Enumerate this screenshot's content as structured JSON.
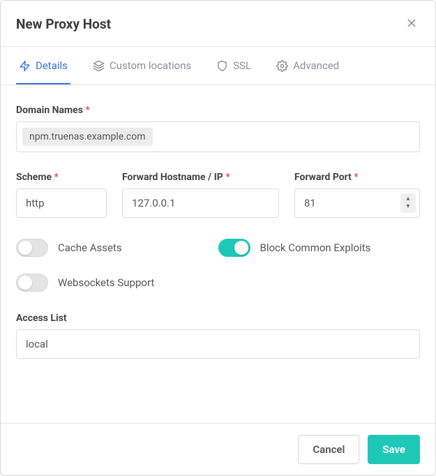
{
  "header": {
    "title": "New Proxy Host"
  },
  "tabs": {
    "details": "Details",
    "custom_locations": "Custom locations",
    "ssl": "SSL",
    "advanced": "Advanced"
  },
  "labels": {
    "domain_names": "Domain Names",
    "scheme": "Scheme",
    "forward_hostname": "Forward Hostname / IP",
    "forward_port": "Forward Port",
    "cache_assets": "Cache Assets",
    "block_exploits": "Block Common Exploits",
    "websockets": "Websockets Support",
    "access_list": "Access List",
    "required_marker": "*"
  },
  "values": {
    "domain_chip": "npm.truenas.example.com",
    "scheme": "http",
    "forward_hostname": "127.0.0.1",
    "forward_port": "81",
    "access_list": "local"
  },
  "toggles": {
    "cache_assets": false,
    "block_exploits": true,
    "websockets": false
  },
  "footer": {
    "cancel": "Cancel",
    "save": "Save"
  }
}
